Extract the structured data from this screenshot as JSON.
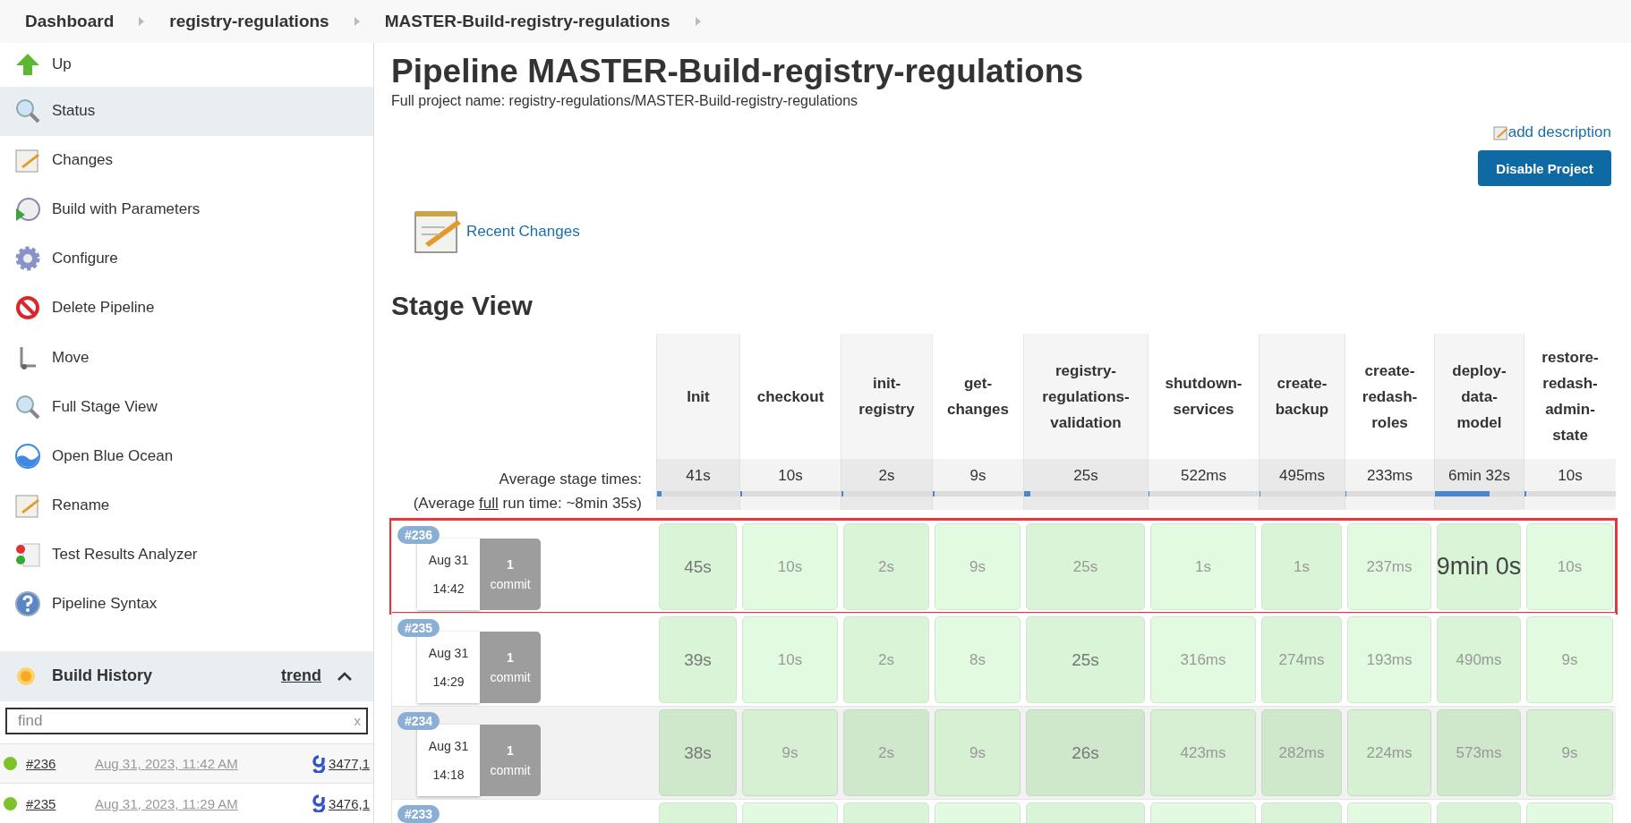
{
  "breadcrumbs": [
    {
      "label": "Dashboard"
    },
    {
      "label": "registry-regulations"
    },
    {
      "label": "MASTER-Build-registry-regulations"
    }
  ],
  "sidebar": {
    "items": [
      {
        "label": "Up",
        "selected": false
      },
      {
        "label": "Status",
        "selected": true
      },
      {
        "label": "Changes",
        "selected": false
      },
      {
        "label": "Build with Parameters",
        "selected": false
      },
      {
        "label": "Configure",
        "selected": false
      },
      {
        "label": "Delete Pipeline",
        "selected": false
      },
      {
        "label": "Move",
        "selected": false
      },
      {
        "label": "Full Stage View",
        "selected": false
      },
      {
        "label": "Open Blue Ocean",
        "selected": false
      },
      {
        "label": "Rename",
        "selected": false
      },
      {
        "label": "Test Results Analyzer",
        "selected": false
      },
      {
        "label": "Pipeline Syntax",
        "selected": false
      }
    ]
  },
  "build_history": {
    "title": "Build History",
    "trend": "trend",
    "expanded": true,
    "search": {
      "placeholder": "find",
      "clear": "x"
    },
    "builds": [
      {
        "number": "#236",
        "date": "Aug 31, 2023, 11:42 AM",
        "changes": "3477,1",
        "color": "#7ec22a"
      },
      {
        "number": "#235",
        "date": "Aug 31, 2023, 11:29 AM",
        "changes": "3476,1",
        "color": "#7ec22a"
      }
    ]
  },
  "page": {
    "title": "Pipeline MASTER-Build-registry-regulations",
    "full_name": "Full project name: registry-regulations/MASTER-Build-registry-regulations",
    "add_description": "add description",
    "disable_button": "Disable Project",
    "recent_changes": "Recent Changes"
  },
  "stage_view": {
    "title": "Stage View",
    "avg_label": "Average stage times:",
    "run_time": {
      "before": "(Average ",
      "link": "full",
      "after": " run time: ~8min 35s)"
    },
    "stages": [
      {
        "name": "Init",
        "average": "41s",
        "level": 0.05
      },
      {
        "name": "checkout",
        "average": "10s",
        "level": 0.02
      },
      {
        "name": "init-registry",
        "average": "2s",
        "level": 0.02
      },
      {
        "name": "get-changes",
        "average": "9s",
        "level": 0.02
      },
      {
        "name": "registry-regulations-validation",
        "average": "25s",
        "level": 0.05
      },
      {
        "name": "shutdown-services",
        "average": "522ms",
        "level": 0.01
      },
      {
        "name": "create-backup",
        "average": "495ms",
        "level": 0.01
      },
      {
        "name": "create-redash-roles",
        "average": "233ms",
        "level": 0.01
      },
      {
        "name": "deploy-data-model",
        "average": "6min 32s",
        "level": 0.62
      },
      {
        "name": "restore-redash-admin-state",
        "average": "10s",
        "level": 0.02
      }
    ],
    "builds": [
      {
        "badge": "#236",
        "date": "Aug 31",
        "time": "14:42",
        "commit_count": "1",
        "commit_label": "commit",
        "highlighted": true,
        "cells": [
          {
            "time": "45s",
            "kind": "mild"
          },
          {
            "time": "10s",
            "kind": "plain"
          },
          {
            "time": "2s",
            "kind": "plain"
          },
          {
            "time": "9s",
            "kind": "plain"
          },
          {
            "time": "25s",
            "kind": "plain"
          },
          {
            "time": "1s",
            "kind": "plain"
          },
          {
            "time": "1s",
            "kind": "plain"
          },
          {
            "time": "237ms",
            "kind": "plain"
          },
          {
            "time": "9min 0s",
            "kind": "strong"
          },
          {
            "time": "10s",
            "kind": "plain"
          }
        ]
      },
      {
        "badge": "#235",
        "date": "Aug 31",
        "time": "14:29",
        "commit_count": "1",
        "commit_label": "commit",
        "highlighted": false,
        "cells": [
          {
            "time": "39s",
            "kind": "mild"
          },
          {
            "time": "10s",
            "kind": "plain"
          },
          {
            "time": "2s",
            "kind": "plain"
          },
          {
            "time": "8s",
            "kind": "plain"
          },
          {
            "time": "25s",
            "kind": "mild"
          },
          {
            "time": "316ms",
            "kind": "plain"
          },
          {
            "time": "274ms",
            "kind": "plain"
          },
          {
            "time": "193ms",
            "kind": "plain"
          },
          {
            "time": "490ms",
            "kind": "plain"
          },
          {
            "time": "9s",
            "kind": "plain"
          }
        ]
      },
      {
        "badge": "#234",
        "date": "Aug 31",
        "time": "14:18",
        "commit_count": "1",
        "commit_label": "commit",
        "highlighted": false,
        "cells": [
          {
            "time": "38s",
            "kind": "mild"
          },
          {
            "time": "9s",
            "kind": "plain"
          },
          {
            "time": "2s",
            "kind": "plain"
          },
          {
            "time": "9s",
            "kind": "plain"
          },
          {
            "time": "26s",
            "kind": "mild"
          },
          {
            "time": "423ms",
            "kind": "plain"
          },
          {
            "time": "282ms",
            "kind": "plain"
          },
          {
            "time": "224ms",
            "kind": "plain"
          },
          {
            "time": "573ms",
            "kind": "plain"
          },
          {
            "time": "9s",
            "kind": "plain"
          }
        ]
      },
      {
        "badge": "#233",
        "highlighted": false
      }
    ]
  }
}
